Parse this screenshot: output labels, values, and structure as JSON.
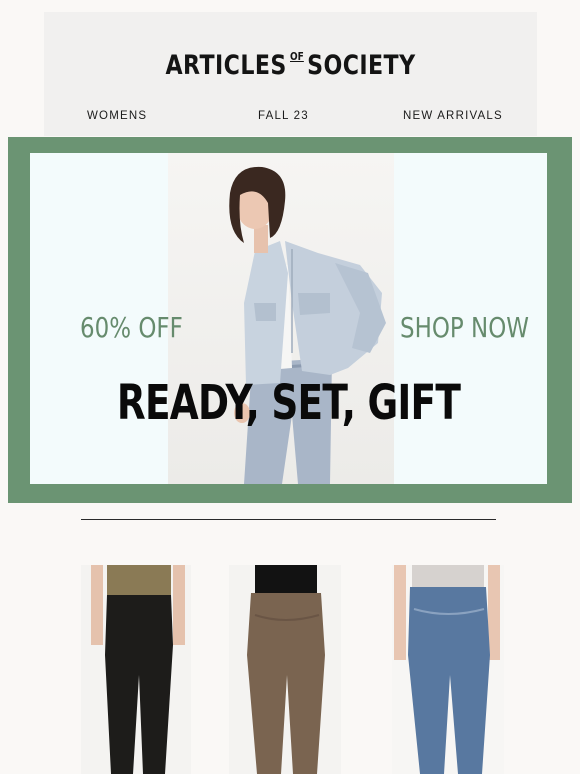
{
  "header": {
    "logo_left": "ARTICLES",
    "logo_of": "OF",
    "logo_right": "SOCIETY"
  },
  "nav": {
    "items": [
      "WOMENS",
      "FALL 23",
      "NEW ARRIVALS"
    ]
  },
  "hero": {
    "discount": "60% OFF",
    "cta": "SHOP NOW",
    "headline": "READY, SET, GIFT",
    "colors": {
      "frame": "#6b9473",
      "accent_text": "#668b6d"
    }
  },
  "products": [
    {
      "name": "black-skinny-jeans",
      "top_color": "#8a7a55",
      "pant_color": "#1d1c1a"
    },
    {
      "name": "brown-skinny-jeans",
      "top_color": "#121212",
      "pant_color": "#7a6450"
    },
    {
      "name": "blue-skinny-jeans",
      "top_color": "#d6d2cf",
      "pant_color": "#5878a0"
    }
  ]
}
